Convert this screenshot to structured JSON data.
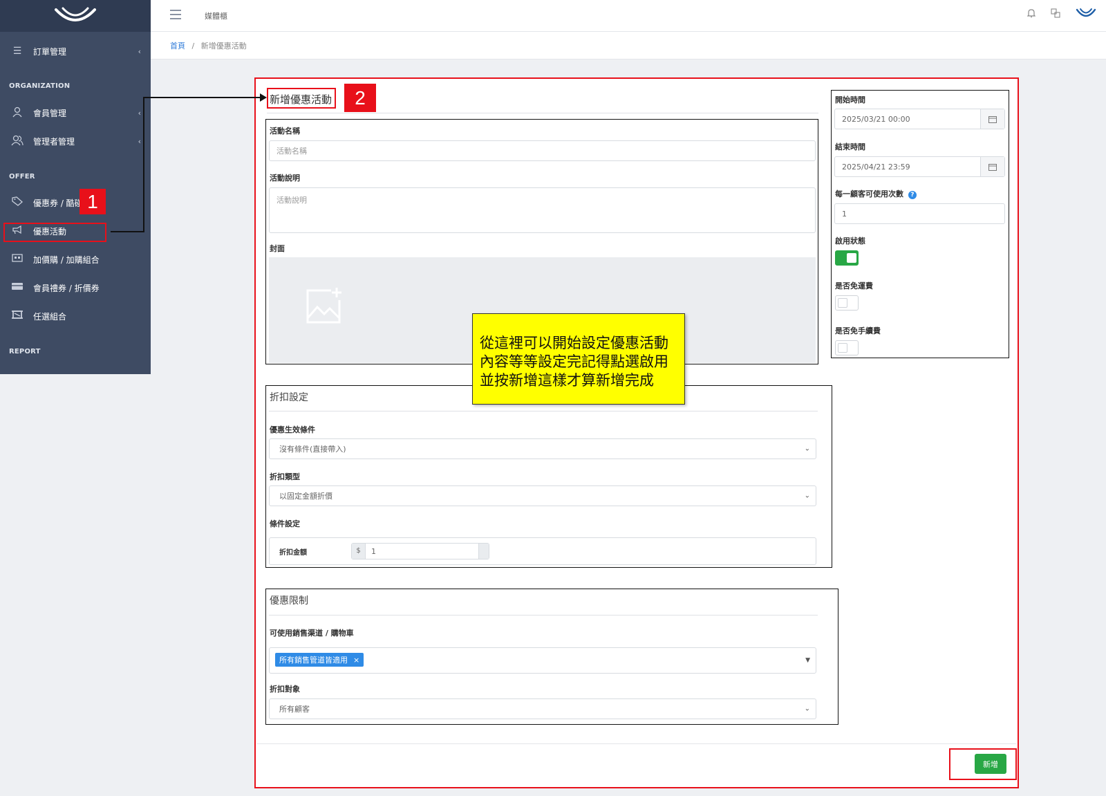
{
  "topbar": {
    "title": "媒體櫃"
  },
  "breadcrumb": {
    "home": "首頁",
    "separator": "/",
    "current": "新增優惠活動"
  },
  "sidebar": {
    "order_mgmt": "訂單管理",
    "sections": {
      "organization": "ORGANIZATION",
      "offer": "OFFER",
      "report": "REPORT"
    },
    "member_mgmt": "會員管理",
    "admin_mgmt": "管理者管理",
    "coupon": "優惠券 / 酷碰",
    "promo": "優惠活動",
    "addon": "加價購 / 加購組合",
    "gift_voucher": "會員禮券 / 折價券",
    "combo": "任選組合"
  },
  "annotations": {
    "badge1": "1",
    "badge2": "2",
    "tip_line1": "從這裡可以開始設定優惠活動",
    "tip_line2": "內容等等設定完記得點選啟用",
    "tip_line3": "並按新增這樣才算新增完成"
  },
  "form": {
    "title": "新增優惠活動",
    "name_label": "活動名稱",
    "name_placeholder": "活動名稱",
    "desc_label": "活動說明",
    "desc_placeholder": "活動說明",
    "cover_label": "封面"
  },
  "side": {
    "start_label": "開始時間",
    "start_value": "2025/03/21 00:00",
    "end_label": "結束時間",
    "end_value": "2025/04/21 23:59",
    "per_customer_label": "每一顧客可使用次數",
    "per_customer_value": "1",
    "enabled_label": "啟用狀態",
    "enabled": true,
    "free_shipping_label": "是否免運費",
    "free_shipping": false,
    "free_fee_label": "是否免手續費",
    "free_fee": false
  },
  "discount": {
    "title": "折扣設定",
    "condition_label": "優惠生效條件",
    "condition_value": "沒有條件(直接帶入)",
    "type_label": "折扣類型",
    "type_value": "以固定金額折價",
    "rule_label": "條件設定",
    "amount_label": "折扣金額",
    "currency": "$",
    "amount_value": "1"
  },
  "limits": {
    "title": "優惠限制",
    "channel_label": "可使用銷售渠道 / 購物車",
    "channel_tag": "所有銷售管道皆適用",
    "tag_remove": "×",
    "target_label": "折扣對象",
    "target_value": "所有顧客"
  },
  "actions": {
    "add": "新增"
  },
  "colors": {
    "sidebar": "#3e4b63",
    "annotation_red": "#e8101a",
    "tip_yellow": "#ffff00",
    "success": "#28a745",
    "tag_blue": "#2f8be6"
  }
}
